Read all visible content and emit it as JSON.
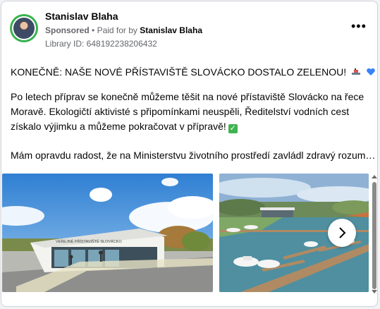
{
  "post": {
    "author": "Stanislav Blaha",
    "sponsored": "Sponsored",
    "paid_for_prefix": "Paid for by",
    "paid_for_name": "Stanislav Blaha",
    "library_id": "Library ID: 648192238206432",
    "paragraph1": "KONEČNĚ: NAŠE NOVÉ PŘÍSTAVIŠTĚ SLOVÁCKO DOSTALO ZELENOU!",
    "paragraph2": "Po letech příprav se konečně můžeme těšit na nové přístaviště Slovácko na řece Moravě. Ekologičtí aktivisté s připomínkami neuspěli, Ředitelství vodních cest získalo výjimku a můžeme pokračovat v přípravě!",
    "paragraph3": "Mám opravdu radost, že na Ministerstvu životního prostředí zavládl zdravý rozum…",
    "building_sign": "VEŘEJNÉ PŘÍSTAVIŠTĚ SLOVÁCKO"
  },
  "icons": {
    "more": "more-horizontal-icon",
    "ship": "ship-emoji-icon",
    "heart": "blue-heart-emoji-icon",
    "check": "check-mark-emoji-icon",
    "next": "chevron-right-icon"
  },
  "colors": {
    "avatar_ring": "#37b24d",
    "heart": "#3b82f6",
    "check": "#3fb34f"
  }
}
